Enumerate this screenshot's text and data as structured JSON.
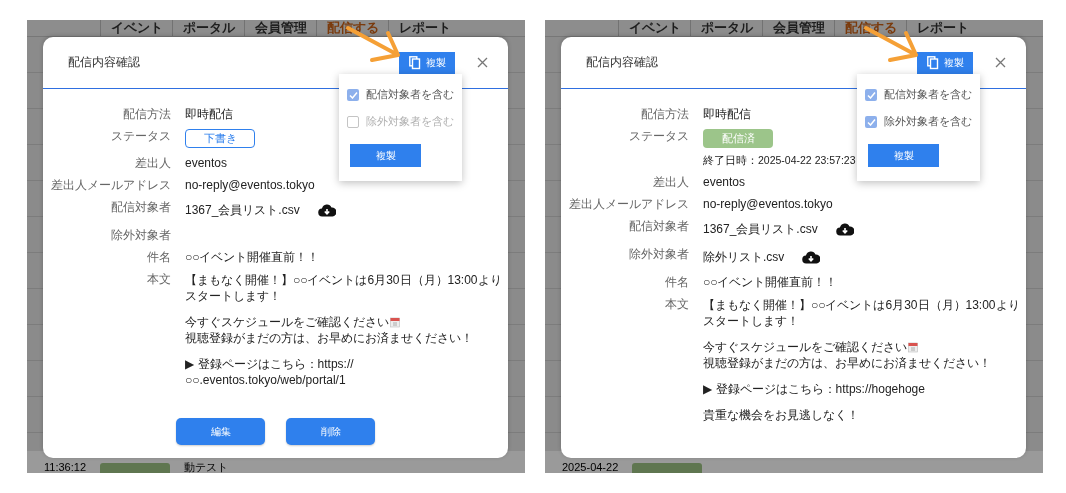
{
  "panels": [
    {
      "nav_tabs": [
        {
          "label": "イベント",
          "selected": false
        },
        {
          "label": "ポータル",
          "selected": false
        },
        {
          "label": "会員管理",
          "selected": false
        },
        {
          "label": "配信する",
          "selected": true
        },
        {
          "label": "レポート",
          "selected": false
        }
      ],
      "background_row": [
        "11:36:12",
        "動テスト"
      ],
      "dialog": {
        "title": "配信内容確認",
        "copy_button": "複製",
        "copy_menu": {
          "options": [
            {
              "label": "配信対象者を含む",
              "checked": true,
              "disabled": false
            },
            {
              "label": "除外対象者を含む",
              "checked": false,
              "disabled": true
            }
          ],
          "button": "複製"
        },
        "fields": [
          {
            "kind": "text",
            "label": "配信方法",
            "value": "即時配信"
          },
          {
            "kind": "status",
            "label": "ステータス",
            "status": {
              "label": "下書き",
              "kind": "draft"
            }
          },
          {
            "kind": "text",
            "label": "差出人",
            "value": "eventos"
          },
          {
            "kind": "text",
            "label": "差出人メールアドレス",
            "value": "no-reply@eventos.tokyo"
          },
          {
            "kind": "file",
            "label": "配信対象者",
            "value": "1367_会員リスト.csv"
          },
          {
            "kind": "text",
            "label": "除外対象者"
          },
          {
            "kind": "text",
            "label": "件名",
            "value": "○○イベント開催直前！！"
          },
          {
            "kind": "body",
            "label": "本文",
            "paragraphs": [
              [
                {
                  "kind": "plain",
                  "text": "【まもなく開催！】○○イベントは6月30日（月）13:00よりスタートします！"
                }
              ],
              [
                {
                  "kind": "icon-after",
                  "text": "今すぐスケジュールをご確認ください"
                },
                {
                  "kind": "plain",
                  "text": "視聴登録がまだの方は、お早めにお済ませください！"
                }
              ],
              [
                {
                  "kind": "nowrap",
                  "text": "▶ 登録ページはこちら：https://○○.eventos.tokyo/web/portal/1"
                }
              ]
            ]
          }
        ],
        "actions": [
          "編集",
          "削除"
        ]
      }
    },
    {
      "nav_tabs": [
        {
          "label": "イベント",
          "selected": false
        },
        {
          "label": "ポータル",
          "selected": false
        },
        {
          "label": "会員管理",
          "selected": false
        },
        {
          "label": "配信する",
          "selected": true
        },
        {
          "label": "レポート",
          "selected": false
        }
      ],
      "background_row": [
        "2025-04-22"
      ],
      "dialog": {
        "title": "配信内容確認",
        "copy_button": "複製",
        "copy_menu": {
          "options": [
            {
              "label": "配信対象者を含む",
              "checked": true,
              "disabled": false
            },
            {
              "label": "除外対象者を含む",
              "checked": true,
              "disabled": false
            }
          ],
          "button": "複製"
        },
        "fields": [
          {
            "kind": "text",
            "label": "配信方法",
            "value": "即時配信"
          },
          {
            "kind": "status",
            "label": "ステータス",
            "status": {
              "label": "配信済",
              "kind": "sent",
              "end_time": "終了日時：2025-04-22 23:57:23"
            }
          },
          {
            "kind": "text",
            "label": "差出人",
            "value": "eventos"
          },
          {
            "kind": "text",
            "label": "差出人メールアドレス",
            "value": "no-reply@eventos.tokyo"
          },
          {
            "kind": "file",
            "label": "配信対象者",
            "value": "1367_会員リスト.csv"
          },
          {
            "kind": "file",
            "label": "除外対象者",
            "value": "除外リスト.csv"
          },
          {
            "kind": "text",
            "label": "件名",
            "value": "○○イベント開催直前！！"
          },
          {
            "kind": "body",
            "label": "本文",
            "paragraphs": [
              [
                {
                  "kind": "plain",
                  "text": "【まもなく開催！】○○イベントは6月30日（月）13:00よりスタートします！"
                }
              ],
              [
                {
                  "kind": "icon-after",
                  "text": "今すぐスケジュールをご確認ください"
                },
                {
                  "kind": "plain",
                  "text": "視聴登録がまだの方は、お早めにお済ませください！"
                }
              ],
              [
                {
                  "kind": "nowrap",
                  "text": "▶ 登録ページはこちら：https://hogehoge"
                }
              ],
              [
                {
                  "kind": "plain",
                  "text": "貴重な機会をお見逃しなく！"
                }
              ]
            ]
          }
        ]
      }
    }
  ]
}
